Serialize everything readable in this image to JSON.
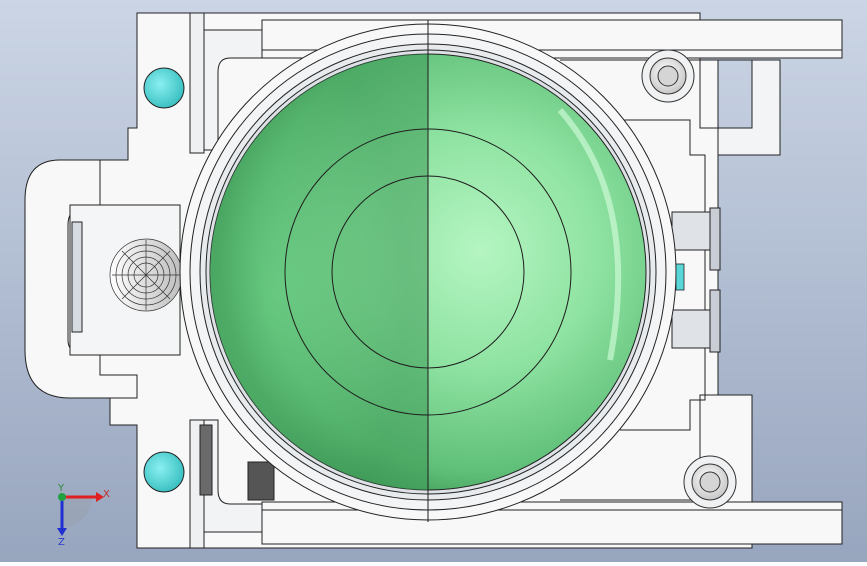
{
  "viewport": {
    "background_top": "#c9d4e4",
    "background_bottom": "#98a6bf",
    "part_fill": "#f7f8f9",
    "edge_color": "#222222",
    "cyan_color": "#59d6d8",
    "button_green": "#7ed593"
  },
  "triad": {
    "x_label": "X",
    "y_label": "Y",
    "z_label": "Z",
    "x_color": "#e02020",
    "y_color": "#20a040",
    "z_color": "#2030d0"
  }
}
